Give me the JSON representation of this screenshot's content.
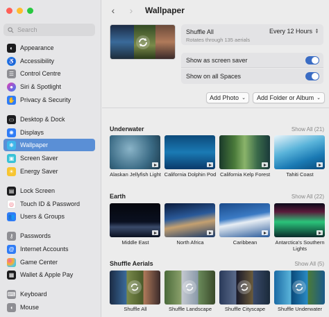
{
  "window": {
    "traffic_lights": [
      {
        "name": "close",
        "color": "#ff5f57"
      },
      {
        "name": "minimize",
        "color": "#febc2e"
      },
      {
        "name": "zoom",
        "color": "#28c840"
      }
    ]
  },
  "search": {
    "placeholder": "Search"
  },
  "sidebar": {
    "items": [
      {
        "label": "Appearance",
        "icon": "appearance-icon",
        "color": "#1c1c1e"
      },
      {
        "label": "Accessibility",
        "icon": "accessibility-icon",
        "color": "#1f7aea"
      },
      {
        "label": "Control Centre",
        "icon": "control-centre-icon",
        "color": "#8e8e93"
      },
      {
        "label": "Siri & Spotlight",
        "icon": "siri-icon",
        "color": "#b549d9"
      },
      {
        "label": "Privacy & Security",
        "icon": "privacy-hand-icon",
        "color": "#2f7cf6"
      },
      {
        "label": "Desktop & Dock",
        "icon": "desktop-dock-icon",
        "color": "#1c1c1e"
      },
      {
        "label": "Displays",
        "icon": "displays-icon",
        "color": "#2f7cf6"
      },
      {
        "label": "Wallpaper",
        "icon": "wallpaper-icon",
        "color": "#3fb6ea",
        "active": true
      },
      {
        "label": "Screen Saver",
        "icon": "screen-saver-icon",
        "color": "#39c2d7"
      },
      {
        "label": "Energy Saver",
        "icon": "energy-saver-icon",
        "color": "#f7c531"
      },
      {
        "label": "Lock Screen",
        "icon": "lock-screen-icon",
        "color": "#1c1c1e"
      },
      {
        "label": "Touch ID & Password",
        "icon": "touch-id-icon",
        "color": "#ef5f6f"
      },
      {
        "label": "Users & Groups",
        "icon": "users-groups-icon",
        "color": "#2f7cf6"
      },
      {
        "label": "Passwords",
        "icon": "passwords-key-icon",
        "color": "#8e8e93"
      },
      {
        "label": "Internet Accounts",
        "icon": "internet-accounts-icon",
        "color": "#2f7cf6"
      },
      {
        "label": "Game Center",
        "icon": "game-center-icon",
        "color": "#ffffff"
      },
      {
        "label": "Wallet & Apple Pay",
        "icon": "wallet-icon",
        "color": "#1c1c1e"
      },
      {
        "label": "Keyboard",
        "icon": "keyboard-icon",
        "color": "#8e8e93"
      },
      {
        "label": "Mouse",
        "icon": "mouse-icon",
        "color": "#8e8e93"
      }
    ]
  },
  "header": {
    "title": "Wallpaper"
  },
  "shuffle": {
    "title": "Shuffle All",
    "subtitle": "Rotates through 135 aerials",
    "interval": "Every 12 Hours"
  },
  "options": {
    "screen_saver_label": "Show as screen saver",
    "all_spaces_label": "Show on all Spaces"
  },
  "buttons": {
    "add_photo": "Add Photo",
    "add_folder": "Add Folder or Album"
  },
  "sections": [
    {
      "title": "Underwater",
      "show_all": "Show All (21)",
      "items": [
        "Alaskan Jellyfish Light",
        "California Dolphin Pod",
        "California Kelp Forest",
        "Tahiti Coast"
      ]
    },
    {
      "title": "Earth",
      "show_all": "Show All (22)",
      "items": [
        "Middle East",
        "North Africa",
        "Caribbean",
        "Antarctica's Southern Lights"
      ]
    },
    {
      "title": "Shuffle Aerials",
      "show_all": "Show All (5)",
      "items": [
        "Shuffle All",
        "Shuffle Landscape",
        "Shuffle Cityscape",
        "Shuffle Underwater"
      ]
    }
  ],
  "colors": {
    "accent": "#3a6cc4",
    "selection": "#5a8fd6"
  }
}
